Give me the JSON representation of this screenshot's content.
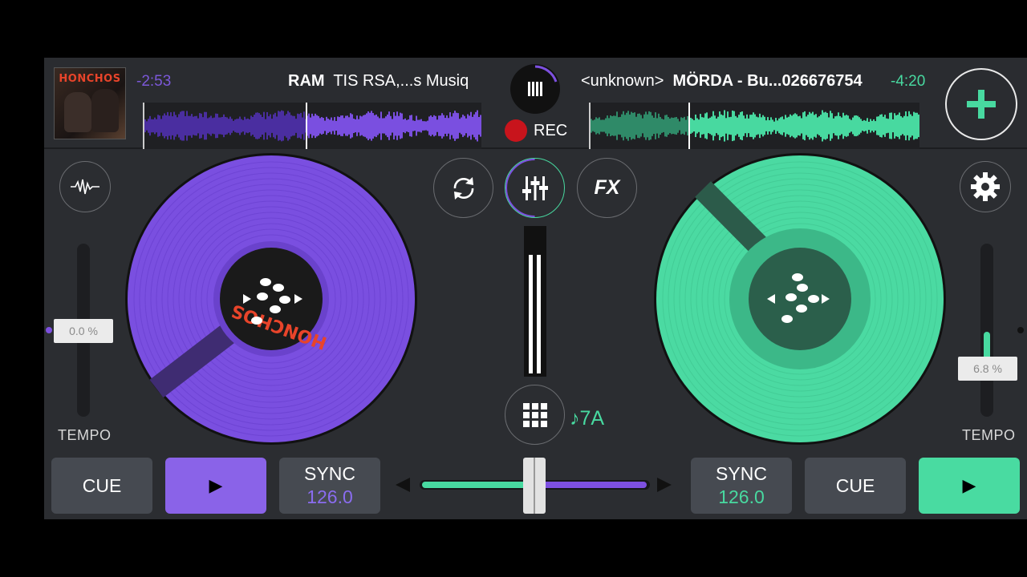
{
  "deck_left": {
    "time_remaining": "-2:53",
    "artist": "RAM",
    "title": "TIS RSA,...s Musiq",
    "album_art_text": "HONCHOS",
    "label_text": "HONCHOS",
    "tempo_value": "0.0 %",
    "tempo_label": "TEMPO",
    "cue_label": "CUE",
    "play_symbol": "▶",
    "sync_label": "SYNC",
    "bpm": "126.0",
    "accent_color": "#7d50e0",
    "waveform_progress": 0.48
  },
  "deck_right": {
    "time_remaining": "-4:20",
    "artist": "<unknown>",
    "title": "MÖRDA - Bu...026676754",
    "tempo_value": "6.8 %",
    "tempo_label": "TEMPO",
    "cue_label": "CUE",
    "play_symbol": "▶",
    "sync_label": "SYNC",
    "bpm": "126.0",
    "accent_color": "#48d9a0",
    "waveform_progress": 0.3,
    "tempo_level": 0.55
  },
  "center": {
    "rec_label": "REC",
    "key_label": "♪7A",
    "crossfader_position": 0.5
  },
  "icons": {
    "top_center": "equalizer-bars-icon",
    "add": "plus-icon",
    "waveform_toggle": "pulse-icon",
    "settings": "gear-icon",
    "loop": "sync-arrows-icon",
    "mixer": "mixer-sliders-icon",
    "fx": "FX",
    "pads": "grid-icon"
  },
  "fx_label": "FX"
}
